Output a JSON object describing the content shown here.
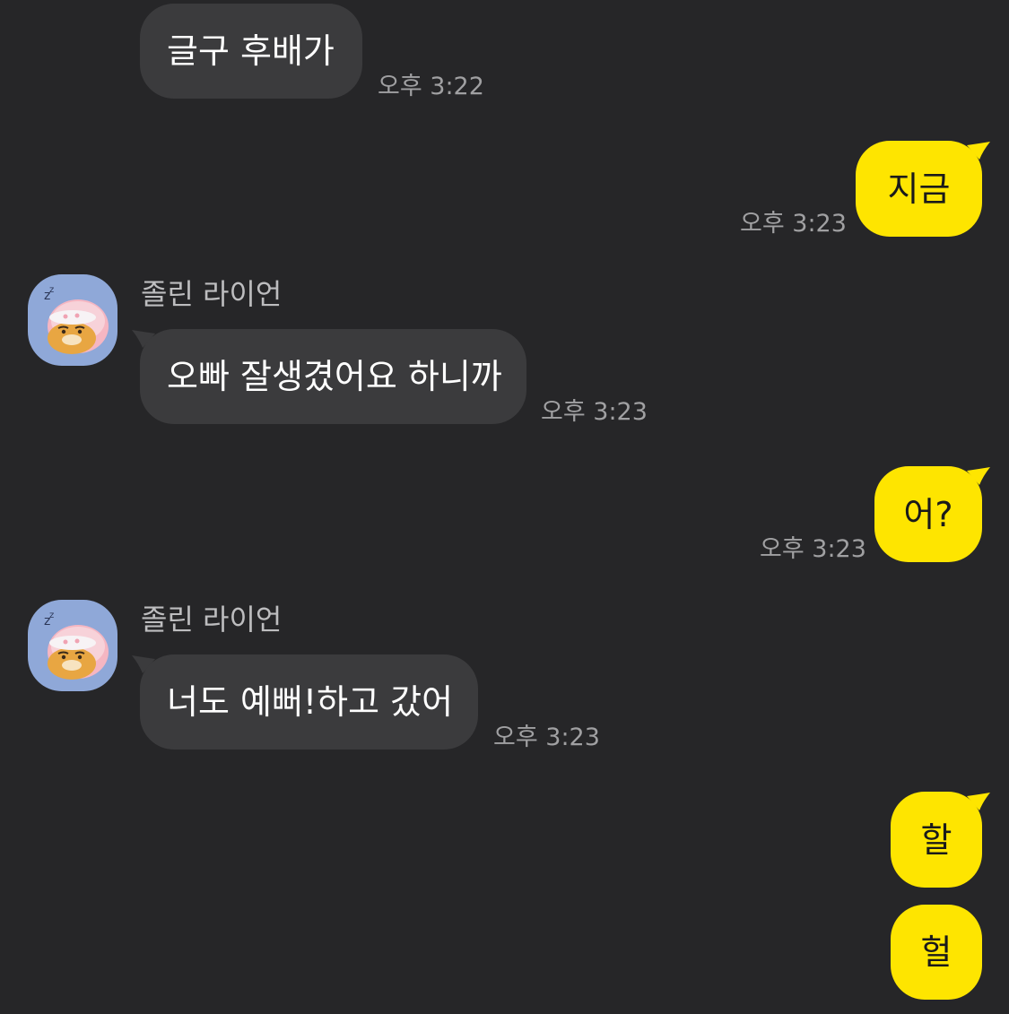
{
  "sender_name": "졸린 라이언",
  "messages": [
    {
      "direction": "in",
      "text": "글구 후배가",
      "time": "오후 3:22"
    },
    {
      "direction": "out",
      "text": "지금",
      "time": "오후 3:23"
    },
    {
      "direction": "in",
      "sender": "졸린 라이언",
      "text": "오빠 잘생겼어요 하니까",
      "time": "오후 3:23"
    },
    {
      "direction": "out",
      "text": "어?",
      "time": "오후 3:23"
    },
    {
      "direction": "in",
      "sender": "졸린 라이언",
      "text": "너도 예뻐!하고 갔어",
      "time": "오후 3:23"
    },
    {
      "direction": "out",
      "text": "할"
    },
    {
      "direction": "out",
      "text": "헐"
    }
  ],
  "colors": {
    "background": "#262628",
    "incoming_bubble": "#3b3b3d",
    "outgoing_bubble": "#fee500",
    "time_text": "#a0a0a2"
  },
  "icons": {
    "avatar": "sleepy-ryan-avatar-icon"
  }
}
